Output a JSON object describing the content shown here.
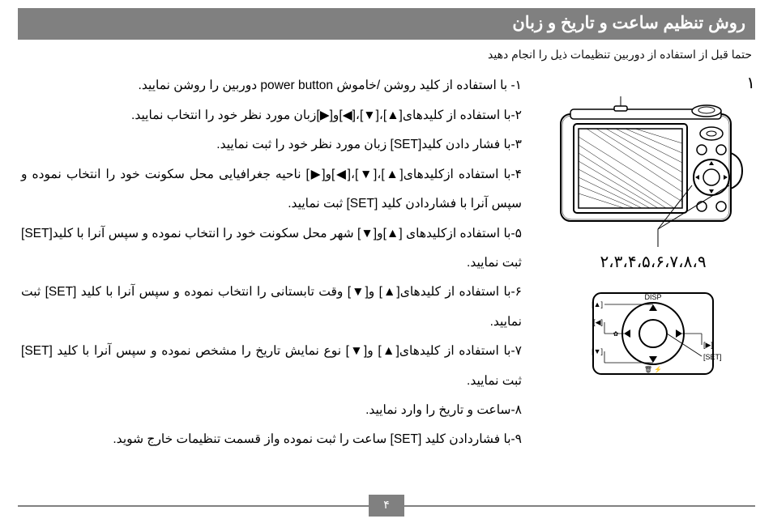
{
  "header_title": "روش تنظیم ساعت و تاریخ و زبان",
  "intro": "حتما قبل از استفاده از دوربین تنظیمات ذیل را انجام دهید",
  "steps": [
    "۱- با استفاده از کلید روشن /خاموش power button دوربین را روشن نمایید.",
    "۲-با استفاده از کلیدهای[▲]،[▼]،[◀]و[▶]زبان مورد نظر خود را انتخاب نمایید.",
    "۳-با فشار دادن کلید[SET] زبان مورد نظر خود را ثبت نمایید.",
    "۴-با استفاده ازکلیدهای[▲]،[▼]،[◀]و[▶] ناحیه جغرافیایی محل سکونت خود را انتخاب نموده و سپس آنرا با فشاردادن کلید [SET] ثبت نمایید.",
    "۵-با استفاده ازکلیدهای [▲]و[▼] شهر محل سکونت خود را انتخاب نموده  و سپس آنرا با کلید[SET] ثبت نمایید.",
    "۶-با استفاده از کلیدهای[▲] و[▼] وقت تابستانی را انتخاب نموده و سپس آنرا با کلید [SET] ثبت نمایید.",
    "۷-با استفاده از کلیدهای[▲] و[▼] نوع نمایش تاریخ را مشخص نموده و سپس آنرا با کلید [SET] ثبت نمایید.",
    "۸-ساعت و تاریخ را وارد نمایید.",
    "۹-با فشاردادن کلید [SET] ساعت را ثبت نموده واز قسمت تنظیمات خارج شوید."
  ],
  "callout_top": "۱",
  "callout_bottom": "۲،۳،۴،۵،۶،۷،۸،۹",
  "dial": {
    "up": "[▲]",
    "down": "[▼]",
    "left": "[◀]",
    "right": "[▶]",
    "set": "[SET]",
    "disp": "DISP"
  },
  "page_number": "۴"
}
